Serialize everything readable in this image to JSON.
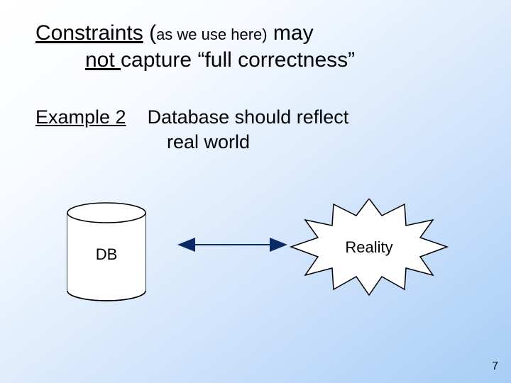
{
  "title": {
    "constraints": "Constraints",
    "open_paren": " (",
    "as_we_use_here": "as we use here)",
    "may": " may",
    "not": "not ",
    "capture": "capture “full correctness”"
  },
  "sub": {
    "example": "Example 2",
    "gap": "    ",
    "line1": "Database should reflect",
    "line2": "real world"
  },
  "diagram": {
    "db_label": "DB",
    "reality_label": "Reality"
  },
  "page_number": "7"
}
